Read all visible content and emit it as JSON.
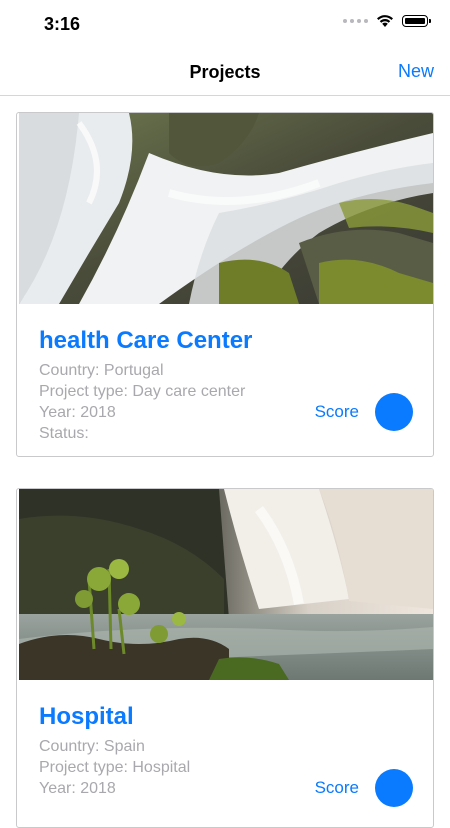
{
  "status_bar": {
    "time": "3:16"
  },
  "nav": {
    "title": "Projects",
    "new_label": "New"
  },
  "projects": [
    {
      "title": "health Care Center",
      "country": "Country: Portugal",
      "project_type": "Project type: Day care center",
      "year": "Year: 2018",
      "status": "Status:",
      "score_label": "Score",
      "image_icon": "waterfall-moss-photo"
    },
    {
      "title": "Hospital",
      "country": "Country: Spain",
      "project_type": "Project type: Hospital",
      "year": "Year: 2018",
      "score_label": "Score",
      "image_icon": "waterfall-lake-photo"
    }
  ],
  "colors": {
    "accent": "#0a7aff",
    "secondary_text": "#a9a9ad"
  }
}
